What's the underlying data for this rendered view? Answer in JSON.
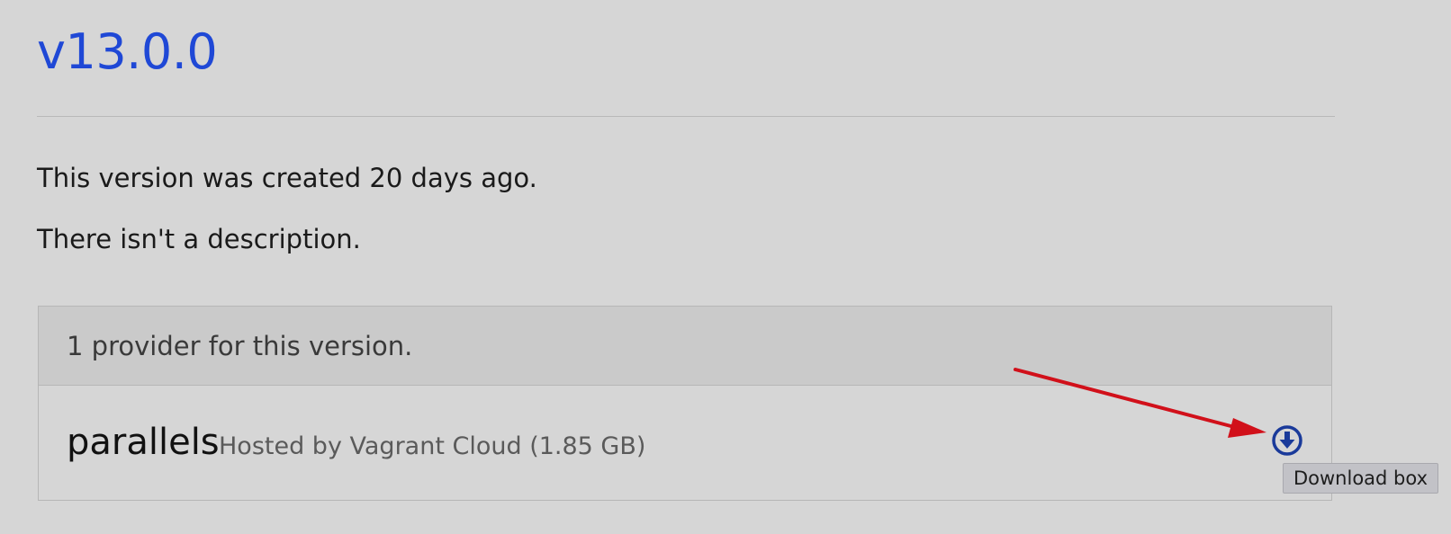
{
  "version": {
    "title": "v13.0.0",
    "created_text": "This version was created 20 days ago.",
    "description_text": "There isn't a description."
  },
  "providers_panel": {
    "heading": "1 provider for this version.",
    "providers": [
      {
        "name": "parallels",
        "hosting": "Hosted by Vagrant Cloud (1.85 GB)",
        "download_icon": "download-circle-icon"
      }
    ]
  },
  "tooltip": {
    "text": "Download box"
  },
  "annotation": {
    "arrow_color": "#d1101a"
  },
  "colors": {
    "background": "#d6d6d6",
    "title_link": "#1f48d6",
    "download_icon": "#1a3a9a"
  }
}
